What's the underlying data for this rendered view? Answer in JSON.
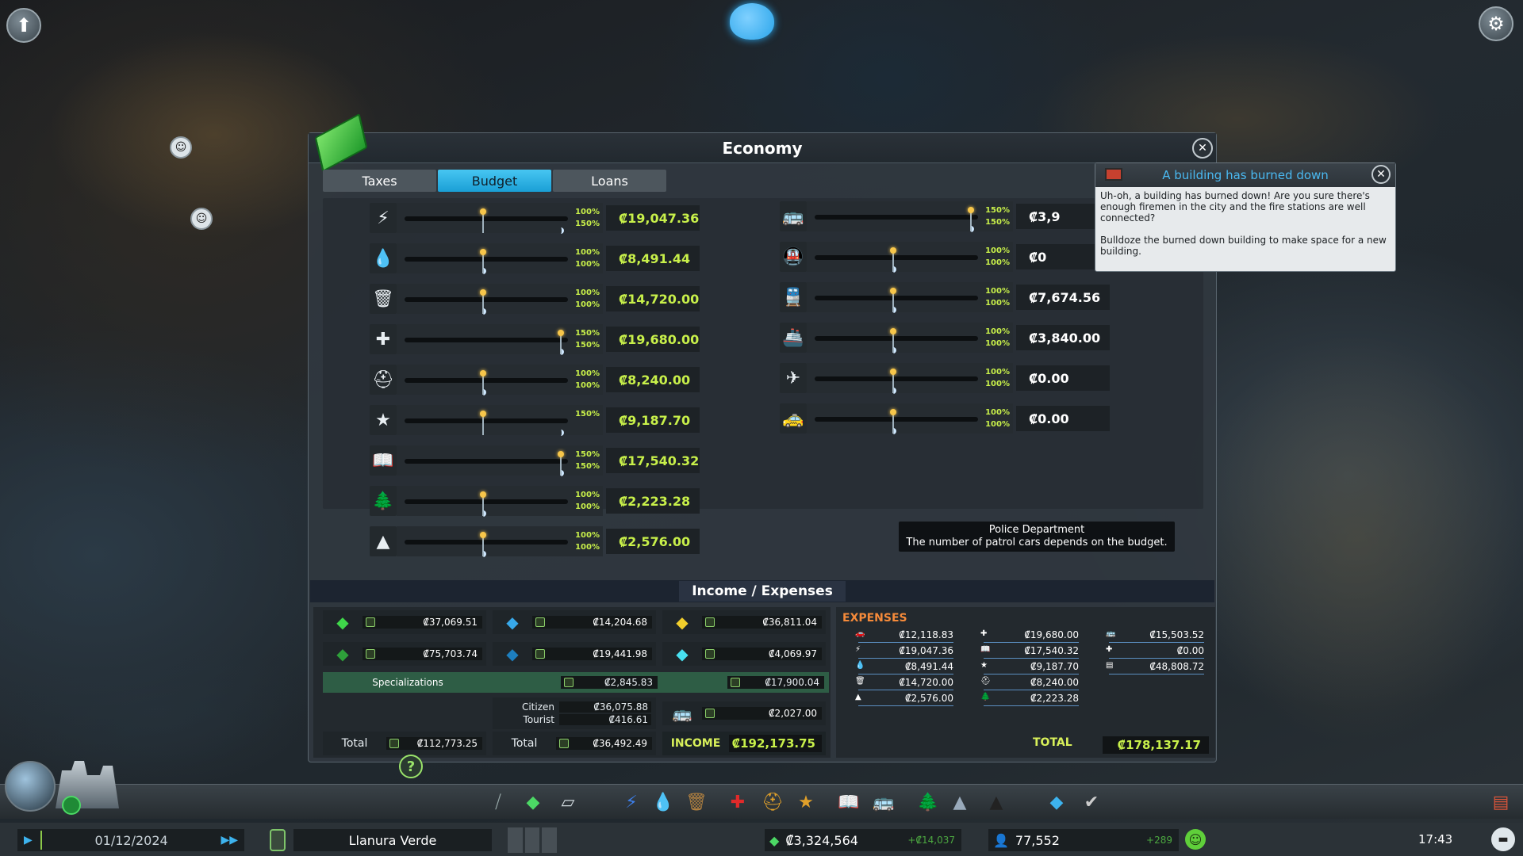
{
  "economy": {
    "title": "Economy",
    "tabs": [
      "Taxes",
      "Budget",
      "Loans"
    ],
    "active_tab": "Budget",
    "budget_left": [
      {
        "icon": "electricity-icon",
        "glyph": "⚡",
        "day_pct": "100%",
        "night_pct": "150%",
        "day_level": 1.0,
        "night_level": 1.5,
        "value": "₡19,047.36"
      },
      {
        "icon": "water-icon",
        "glyph": "💧",
        "day_pct": "100%",
        "night_pct": "100%",
        "day_level": 1.0,
        "night_level": 1.0,
        "value": "₡8,491.44"
      },
      {
        "icon": "garbage-icon",
        "glyph": "🗑",
        "day_pct": "100%",
        "night_pct": "100%",
        "day_level": 1.0,
        "night_level": 1.0,
        "value": "₡14,720.00"
      },
      {
        "icon": "healthcare-icon",
        "glyph": "✚",
        "day_pct": "150%",
        "night_pct": "150%",
        "day_level": 1.5,
        "night_level": 1.5,
        "value": "₡19,680.00"
      },
      {
        "icon": "fire-department-icon",
        "glyph": "⛑",
        "day_pct": "100%",
        "night_pct": "100%",
        "day_level": 1.0,
        "night_level": 1.0,
        "value": "₡8,240.00"
      },
      {
        "icon": "police-icon",
        "glyph": "★",
        "day_pct": "",
        "night_pct": "150%",
        "day_level": 1.0,
        "night_level": 1.5,
        "value": "₡9,187.70"
      },
      {
        "icon": "education-icon",
        "glyph": "📖",
        "day_pct": "150%",
        "night_pct": "150%",
        "day_level": 1.5,
        "night_level": 1.5,
        "value": "₡17,540.32"
      },
      {
        "icon": "parks-icon",
        "glyph": "🌲",
        "day_pct": "100%",
        "night_pct": "100%",
        "day_level": 1.0,
        "night_level": 1.0,
        "value": "₡2,223.28"
      },
      {
        "icon": "monuments-icon",
        "glyph": "▲",
        "day_pct": "100%",
        "night_pct": "100%",
        "day_level": 1.0,
        "night_level": 1.0,
        "value": "₡2,576.00"
      }
    ],
    "budget_right": [
      {
        "icon": "bus-icon",
        "glyph": "🚌",
        "day_pct": "150%",
        "night_pct": "150%",
        "day_level": 1.5,
        "night_level": 1.5,
        "value": "₡3,9"
      },
      {
        "icon": "metro-icon",
        "glyph": "🚇",
        "day_pct": "100%",
        "night_pct": "100%",
        "day_level": 1.0,
        "night_level": 1.0,
        "value": "₡0"
      },
      {
        "icon": "train-icon",
        "glyph": "🚆",
        "day_pct": "100%",
        "night_pct": "100%",
        "day_level": 1.0,
        "night_level": 1.0,
        "value": "₡7,674.56"
      },
      {
        "icon": "ship-icon",
        "glyph": "🚢",
        "day_pct": "100%",
        "night_pct": "100%",
        "day_level": 1.0,
        "night_level": 1.0,
        "value": "₡3,840.00"
      },
      {
        "icon": "airplane-icon",
        "glyph": "✈",
        "day_pct": "100%",
        "night_pct": "100%",
        "day_level": 1.0,
        "night_level": 1.0,
        "value": "₡0.00"
      },
      {
        "icon": "taxi-icon",
        "glyph": "🚕",
        "day_pct": "100%",
        "night_pct": "100%",
        "day_level": 1.0,
        "night_level": 1.0,
        "value": "₡0.00"
      }
    ],
    "tooltip": {
      "title": "Police Department",
      "text": "The number of patrol cars depends on the budget."
    },
    "income_expenses_title": "Income / Expenses",
    "income": {
      "res_low": "₡37,069.51",
      "res_high": "₡75,703.74",
      "com_low": "₡14,204.68",
      "com_high": "₡19,441.98",
      "ind": "₡36,811.04",
      "office": "₡4,069.97",
      "specializations_label": "Specializations",
      "spec_com": "₡2,845.83",
      "spec_ind": "₡17,900.04",
      "citizen_label": "Citizen",
      "citizen": "₡36,075.88",
      "tourist_label": "Tourist",
      "tourist": "₡416.61",
      "transport": "₡2,027.00",
      "total_label": "Total",
      "total_res": "₡112,773.25",
      "total_com": "₡36,492.49",
      "income_label": "INCOME",
      "income_total": "₡192,173.75"
    },
    "expenses": {
      "title": "EXPENSES",
      "col1": [
        "₡12,118.83",
        "₡19,047.36",
        "₡8,491.44",
        "₡14,720.00",
        "₡2,576.00"
      ],
      "col2": [
        "₡19,680.00",
        "₡17,540.32",
        "₡9,187.70",
        "₡8,240.00",
        "₡2,223.28"
      ],
      "col3": [
        "₡15,503.52",
        "₡0.00",
        "₡48,808.72"
      ],
      "total_label": "TOTAL",
      "total": "₡178,137.17"
    }
  },
  "notification": {
    "title": "A building has burned down",
    "body1": "Uh-oh, a building has burned down! Are you sure there's enough firemen in the city and the fire stations are well connected?",
    "body2": "Bulldoze the burned down building to make space for a new building."
  },
  "status": {
    "date": "01/12/2024",
    "city_name": "Llanura Verde",
    "money": "₡3,324,564",
    "money_delta": "+₡14,037",
    "population": "77,552",
    "population_delta": "+289",
    "time": "17:43"
  },
  "colors": {
    "accent": "#1a9fd6",
    "value_green": "#c8f04a",
    "expenses_orange": "#f58a3a"
  }
}
